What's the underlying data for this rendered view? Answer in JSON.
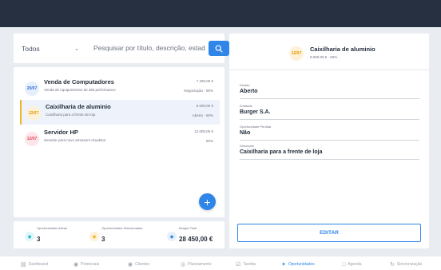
{
  "filter": {
    "selected": "Todos"
  },
  "search": {
    "placeholder": "Pesquisar por título, descrição, estado..."
  },
  "opportunities": [
    {
      "date": "20/07",
      "title": "Venda de Computadores",
      "description": "Venda de equipamentos de alta performance",
      "value": "7.450,00 €",
      "stage": "Negociação · 50%",
      "badge_bg": "#e6effd",
      "badge_fg": "#2f6fd1"
    },
    {
      "date": "12/07",
      "title": "Caixilharia de aluminio",
      "description": "Caixilharia para a frente de loja",
      "value": "9.000,00 €",
      "stage": "Aberto · 60%",
      "badge_bg": "#fdf1d8",
      "badge_fg": "#e09a00"
    },
    {
      "date": "12/07",
      "title": "Servidor HP",
      "description": "Servidor para novo armazem cloudstor",
      "value": "12.000,00 €",
      "stage": "50%",
      "badge_bg": "#fde6ea",
      "badge_fg": "#e0455c"
    }
  ],
  "stats": [
    {
      "label": "Oportunidades Ativas",
      "value": "3",
      "color": "#21b3c8"
    },
    {
      "label": "Oportunidades Selecionadas",
      "value": "3",
      "color": "#f0b429"
    },
    {
      "label": "Budget Total",
      "value": "28 450,00 €",
      "color": "#2f86e8"
    }
  ],
  "detail": {
    "date": "12/07",
    "title": "Caixilharia de aluminio",
    "subtitle": "9.000,00 € · 60%",
    "fields": [
      {
        "label": "Estado",
        "value": "Aberto"
      },
      {
        "label": "Entidade",
        "value": "Burger S.A."
      },
      {
        "label": "Oportunidade Perdida",
        "value": "Não"
      },
      {
        "label": "Descrição",
        "value": "Caixilharia para a frente de loja"
      }
    ],
    "edit_label": "EDITAR"
  },
  "nav": [
    {
      "label": "Dashboard",
      "icon": "bar-chart-icon",
      "active": false
    },
    {
      "label": "Potenciais",
      "icon": "user-circle-icon",
      "active": false
    },
    {
      "label": "Clientes",
      "icon": "users-icon",
      "active": false
    },
    {
      "label": "Planeamento",
      "icon": "lightbulb-icon",
      "active": false
    },
    {
      "label": "Tarefas",
      "icon": "checkbox-icon",
      "active": false
    },
    {
      "label": "Oportunidades",
      "icon": "target-icon",
      "active": true
    },
    {
      "label": "Agenda",
      "icon": "calendar-icon",
      "active": false
    },
    {
      "label": "Sincronização",
      "icon": "sync-icon",
      "active": false
    }
  ]
}
